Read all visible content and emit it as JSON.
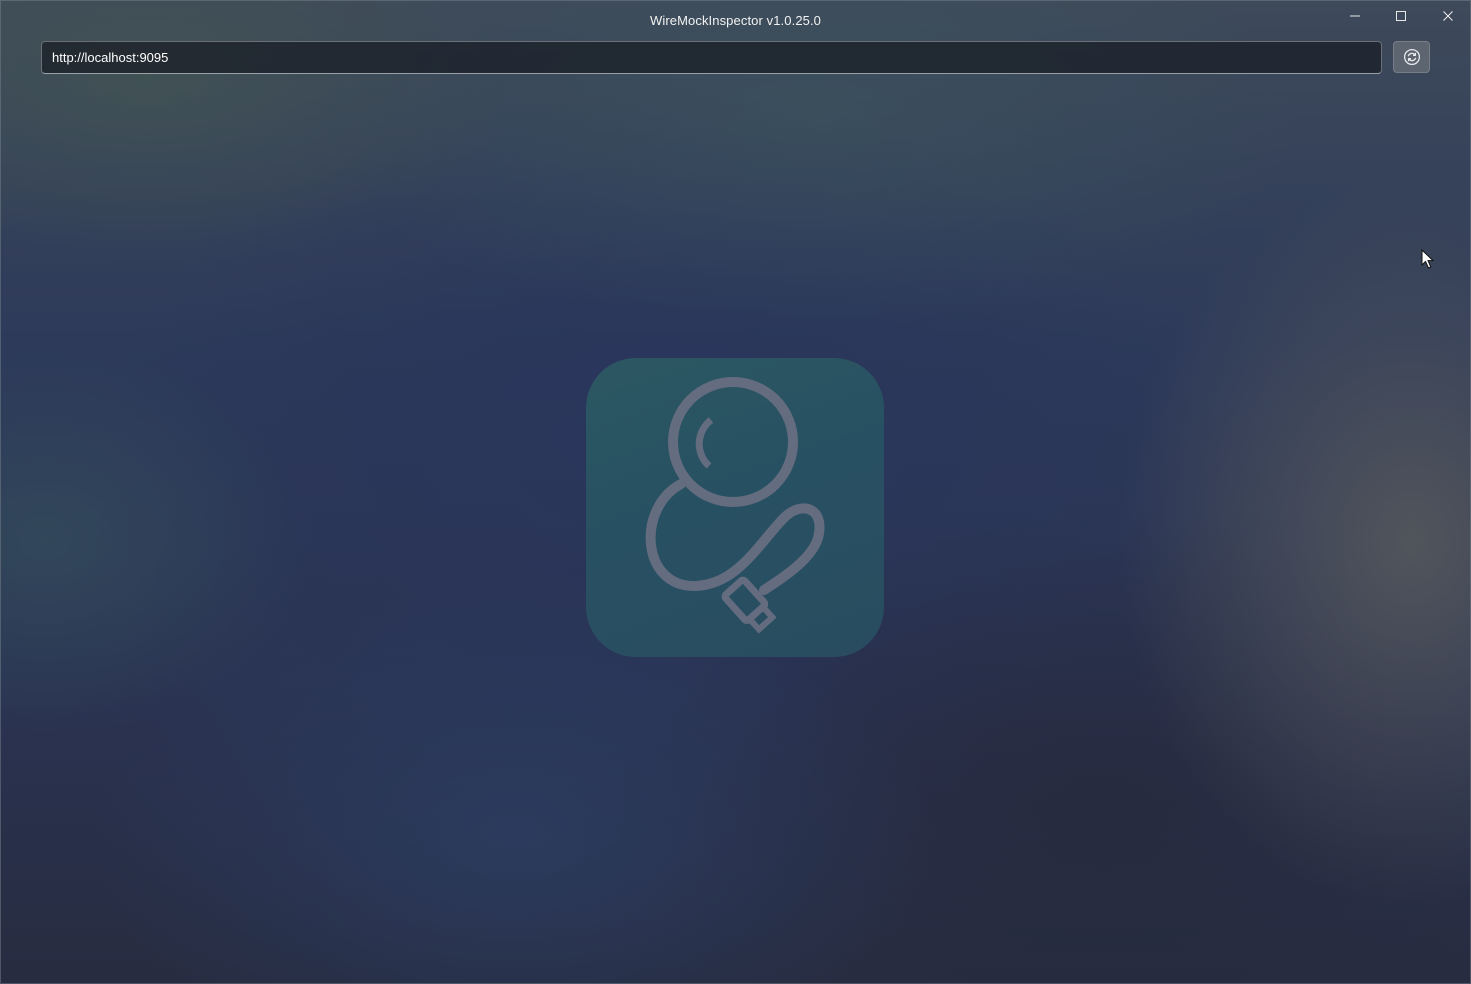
{
  "window": {
    "title": "WireMockInspector v1.0.25.0",
    "caption_buttons": [
      "minimize-icon",
      "maximize-icon",
      "close-icon"
    ]
  },
  "toolbar": {
    "url_value": "http://localhost:9095",
    "refresh_icon": "refresh-icon"
  },
  "splash": {
    "logo_icon": "magnifier-cable-logo",
    "colors": {
      "logo_background": "#275463",
      "logo_stroke": "#6a7184"
    }
  }
}
